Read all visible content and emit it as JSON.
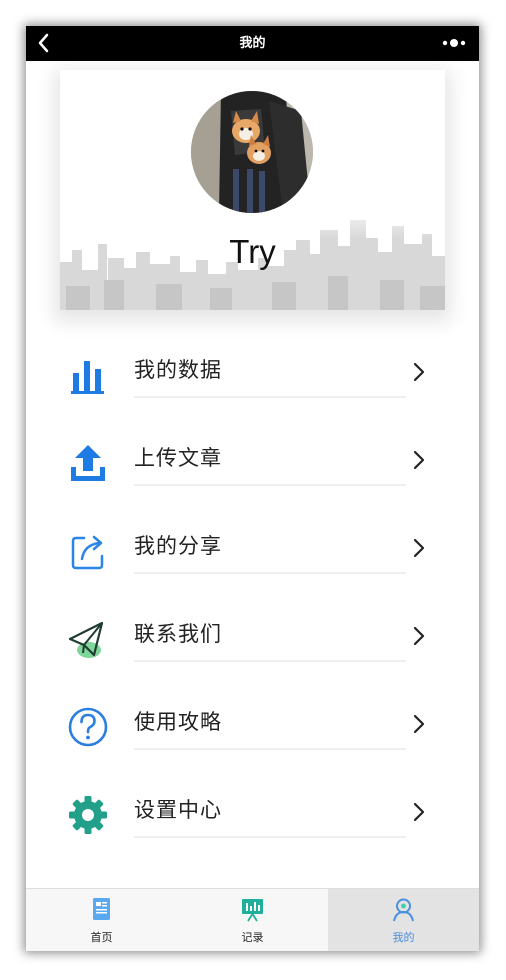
{
  "navbar": {
    "title": "我的",
    "back_icon": "chevron-left-icon",
    "more_icon": "more-dots-icon"
  },
  "profile": {
    "username": "Try",
    "avatar": "avatar-photo"
  },
  "menu": {
    "items": [
      {
        "label": "我的数据",
        "icon": "bar-chart-icon",
        "color": "#1e7be3"
      },
      {
        "label": "上传文章",
        "icon": "upload-icon",
        "color": "#1e7be3"
      },
      {
        "label": "我的分享",
        "icon": "share-icon",
        "color": "#2b85e6"
      },
      {
        "label": "联系我们",
        "icon": "paper-plane-icon",
        "color": "#2aa55e"
      },
      {
        "label": "使用攻略",
        "icon": "help-icon",
        "color": "#2b7fe0"
      },
      {
        "label": "设置中心",
        "icon": "gear-icon",
        "color": "#23a08a"
      }
    ]
  },
  "tabbar": {
    "tabs": [
      {
        "label": "首页",
        "icon": "home-doc-icon",
        "active": false
      },
      {
        "label": "记录",
        "icon": "record-board-icon",
        "active": false
      },
      {
        "label": "我的",
        "icon": "profile-icon",
        "active": true
      }
    ],
    "active_color": "#4a8fe0"
  }
}
